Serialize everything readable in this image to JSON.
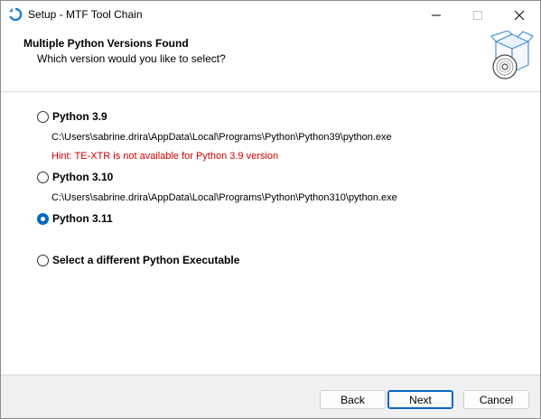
{
  "window": {
    "title": "Setup - MTF Tool Chain",
    "icons": {
      "app": "setup-app-icon",
      "minimize": "minimize-icon",
      "maximize": "maximize-icon",
      "close": "close-icon"
    }
  },
  "header": {
    "title": "Multiple Python Versions Found",
    "subtitle": "Which version would you like to select?",
    "graphic": "install-box-cd-icon"
  },
  "options": [
    {
      "label": "Python 3.9",
      "path": "C:\\Users\\sabrine.drira\\AppData\\Local\\Programs\\Python\\Python39\\python.exe",
      "hint": "Hint: TE-XTR is not available for Python 3.9 version",
      "selected": false
    },
    {
      "label": "Python 3.10",
      "path": "C:\\Users\\sabrine.drira\\AppData\\Local\\Programs\\Python\\Python310\\python.exe",
      "selected": false
    },
    {
      "label": "Python 3.11",
      "selected": true
    },
    {
      "label": "Select a different Python Executable",
      "selected": false
    }
  ],
  "footer": {
    "back_label": "Back",
    "next_label": "Next",
    "cancel_label": "Cancel"
  },
  "colors": {
    "accent": "#0067c0",
    "hint": "#d00000"
  }
}
